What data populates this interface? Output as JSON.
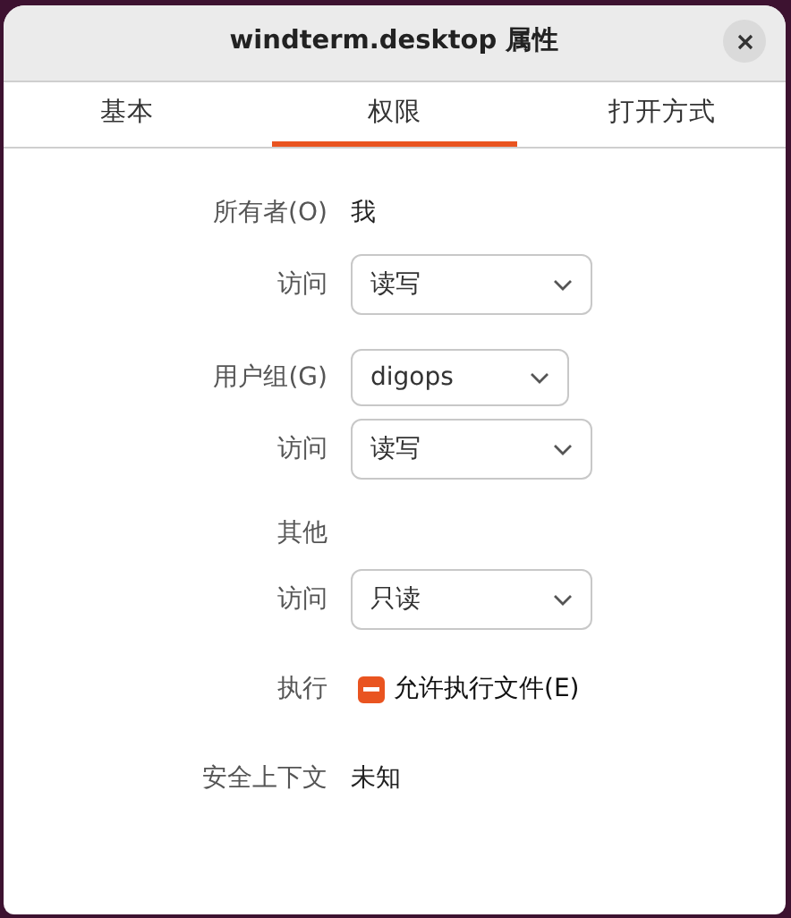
{
  "window": {
    "title": "windterm.desktop 属性"
  },
  "tabs": [
    {
      "label": "基本",
      "selected": false
    },
    {
      "label": "权限",
      "selected": true
    },
    {
      "label": "打开方式",
      "selected": false
    }
  ],
  "rows": [
    {
      "kind": "text",
      "label": "所有者(O)",
      "value": "我"
    },
    {
      "kind": "dropdown",
      "label": "访问",
      "value": "读写"
    },
    {
      "kind": "narrow-dropdown",
      "label": "用户组(G)",
      "value": "digops"
    },
    {
      "kind": "dropdown",
      "label": "访问",
      "value": "读写"
    },
    {
      "kind": "heading",
      "label": "其他"
    },
    {
      "kind": "dropdown",
      "label": "访问",
      "value": "只读"
    },
    {
      "kind": "checkbox",
      "label": "执行",
      "value": "允许执行文件(E)",
      "inconsistent": true
    },
    {
      "kind": "text",
      "label": "安全上下文",
      "value": "未知"
    }
  ]
}
